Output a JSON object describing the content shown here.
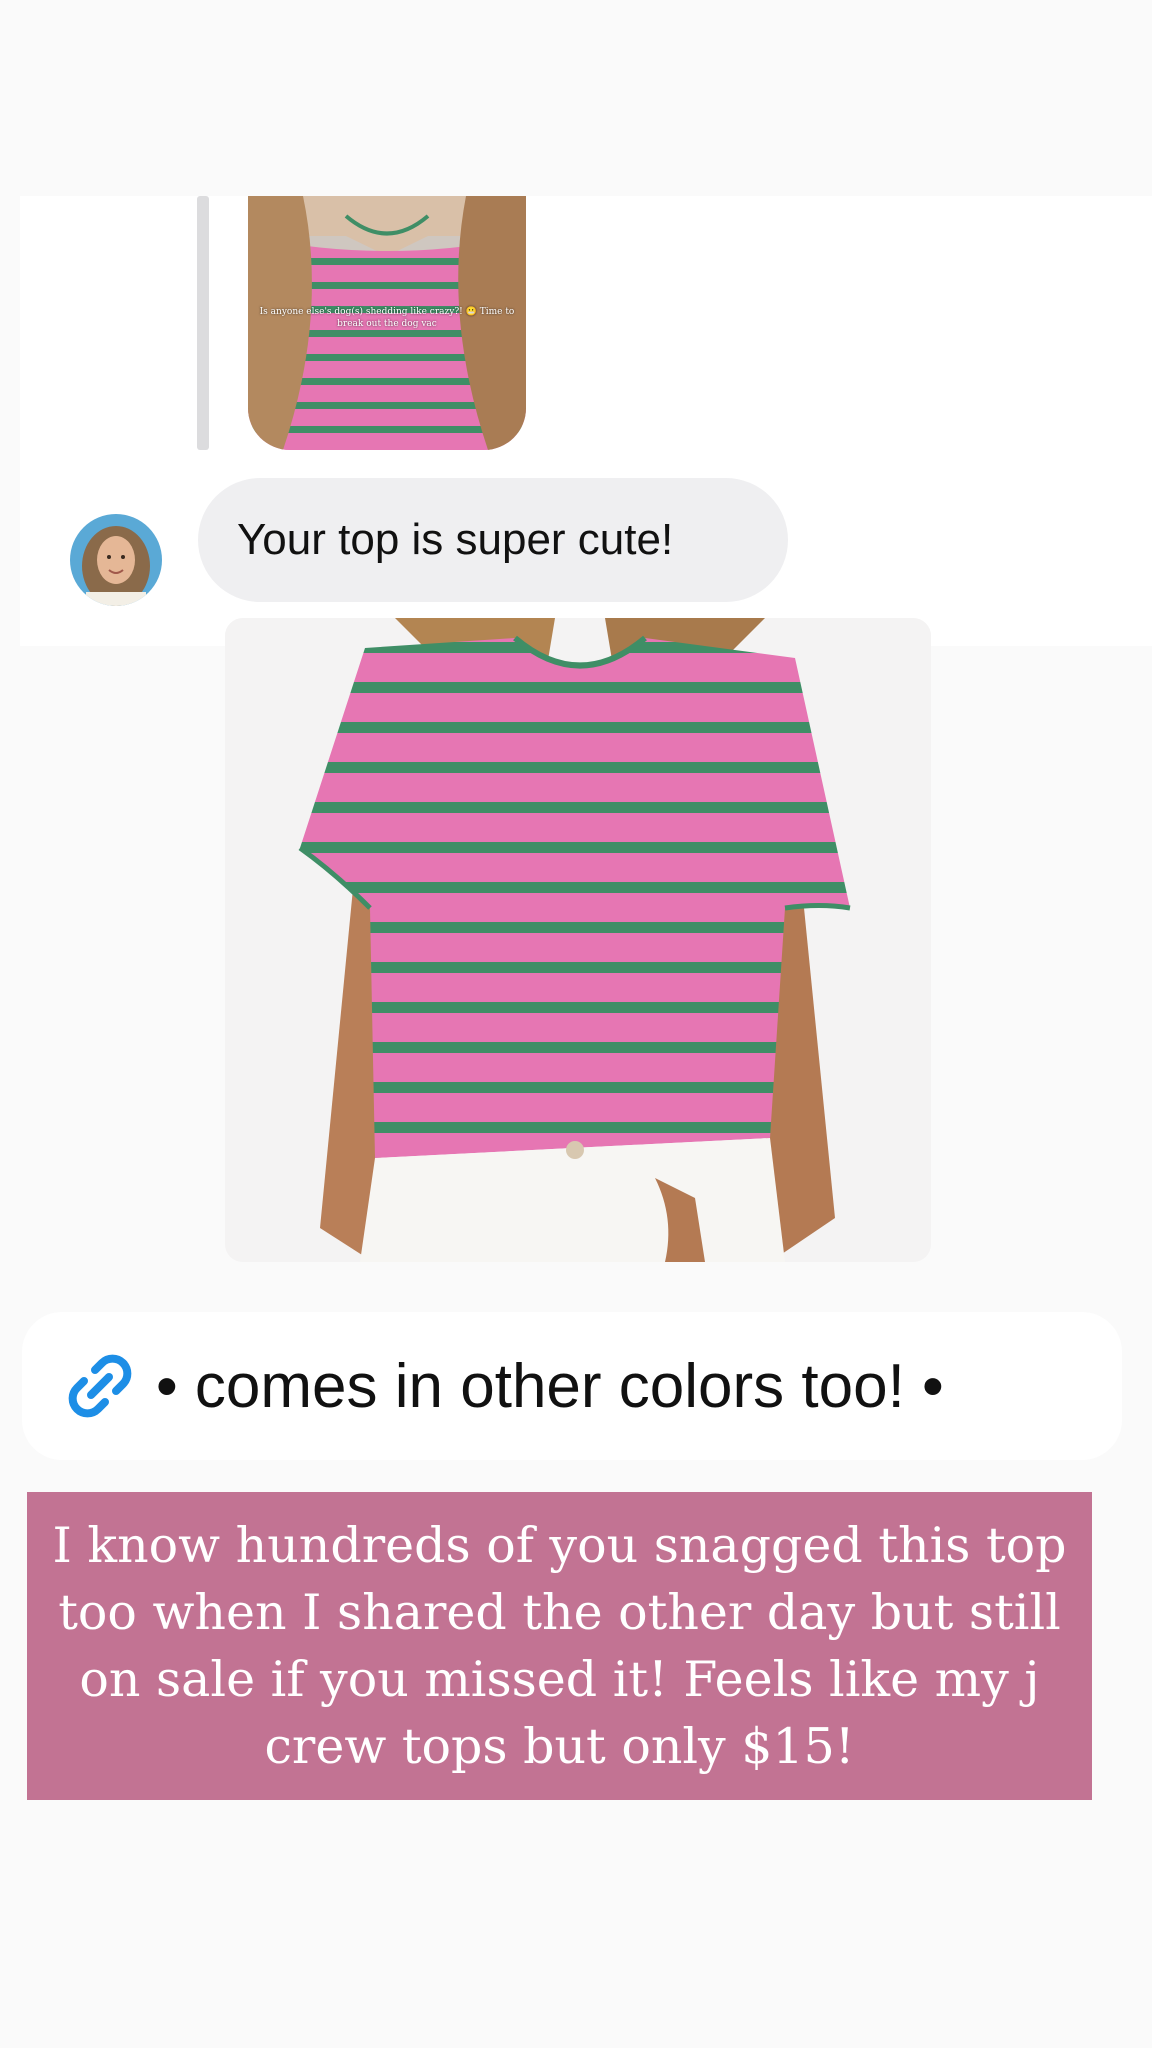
{
  "reply_preview": {
    "caption": "Is anyone else's dog(s) shedding like crazy?! 😬 Time to break out the dog vac"
  },
  "message": {
    "text": "Your top is super cute!"
  },
  "link_sticker": {
    "icon": "link-icon",
    "text": "• comes in other colors too! •",
    "color": "#1d8ee6"
  },
  "caption": {
    "text": "I know hundreds of you snagged this top too when I shared the other day but still on sale if you missed it! Feels like my j crew tops but only $15!",
    "background": "#c27393"
  },
  "colors": {
    "stripe_pink": "#e676b3",
    "stripe_green": "#3f8e66",
    "bubble": "#efeff1"
  }
}
